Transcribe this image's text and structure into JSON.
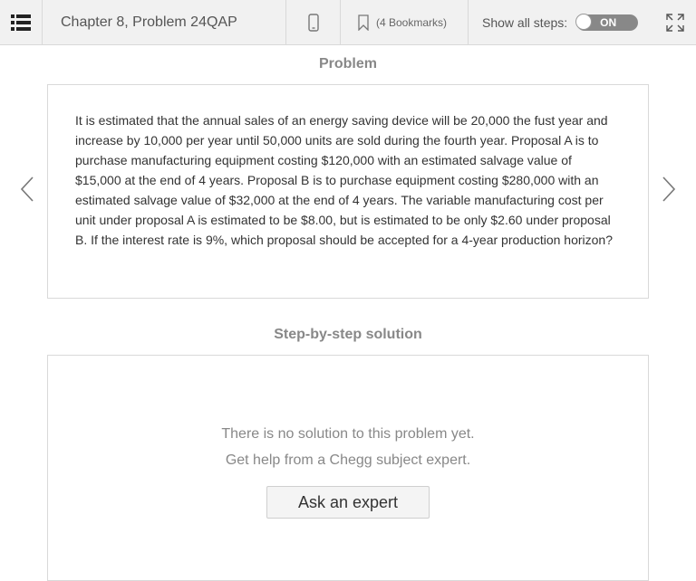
{
  "toolbar": {
    "menu_icon": "list-menu-icon",
    "chapter_title": "Chapter 8, Problem 24QAP",
    "device_icon": "mobile-phone-icon",
    "bookmark_icon": "bookmark-icon",
    "bookmarks_label": "(4 Bookmarks)",
    "show_steps_label": "Show all steps:",
    "toggle_label": "ON",
    "expand_icon": "expand-icon"
  },
  "problem": {
    "heading": "Problem",
    "text": "It is estimated that the annual sales of an energy saving device will be 20,000 the fust year and increase by 10,000 per year until 50,000 units are sold during the fourth year. Proposal A is to purchase manufacturing equipment costing $120,000 with an estimated salvage value of $15,000 at the end of 4 years. Proposal B is to purchase equipment costing $280,000 with an estimated salvage value of $32,000 at the end of 4 years. The variable manufacturing cost per unit under proposal A is estimated to be $8.00, but is estimated to be only $2.60 under proposal B. If the interest rate is 9%, which proposal should be accepted for a 4-year production horizon?"
  },
  "solution": {
    "heading": "Step-by-step solution",
    "no_solution": "There is no solution to this problem yet.",
    "get_help": "Get help from a Chegg subject expert.",
    "ask_button": "Ask an expert"
  },
  "nav": {
    "prev_icon": "chevron-left-icon",
    "next_icon": "chevron-right-icon"
  },
  "colors": {
    "toolbar_bg": "#f1f1f1",
    "border": "#d9d9d9",
    "toggle_bg": "#888888",
    "muted_text": "#888888"
  }
}
